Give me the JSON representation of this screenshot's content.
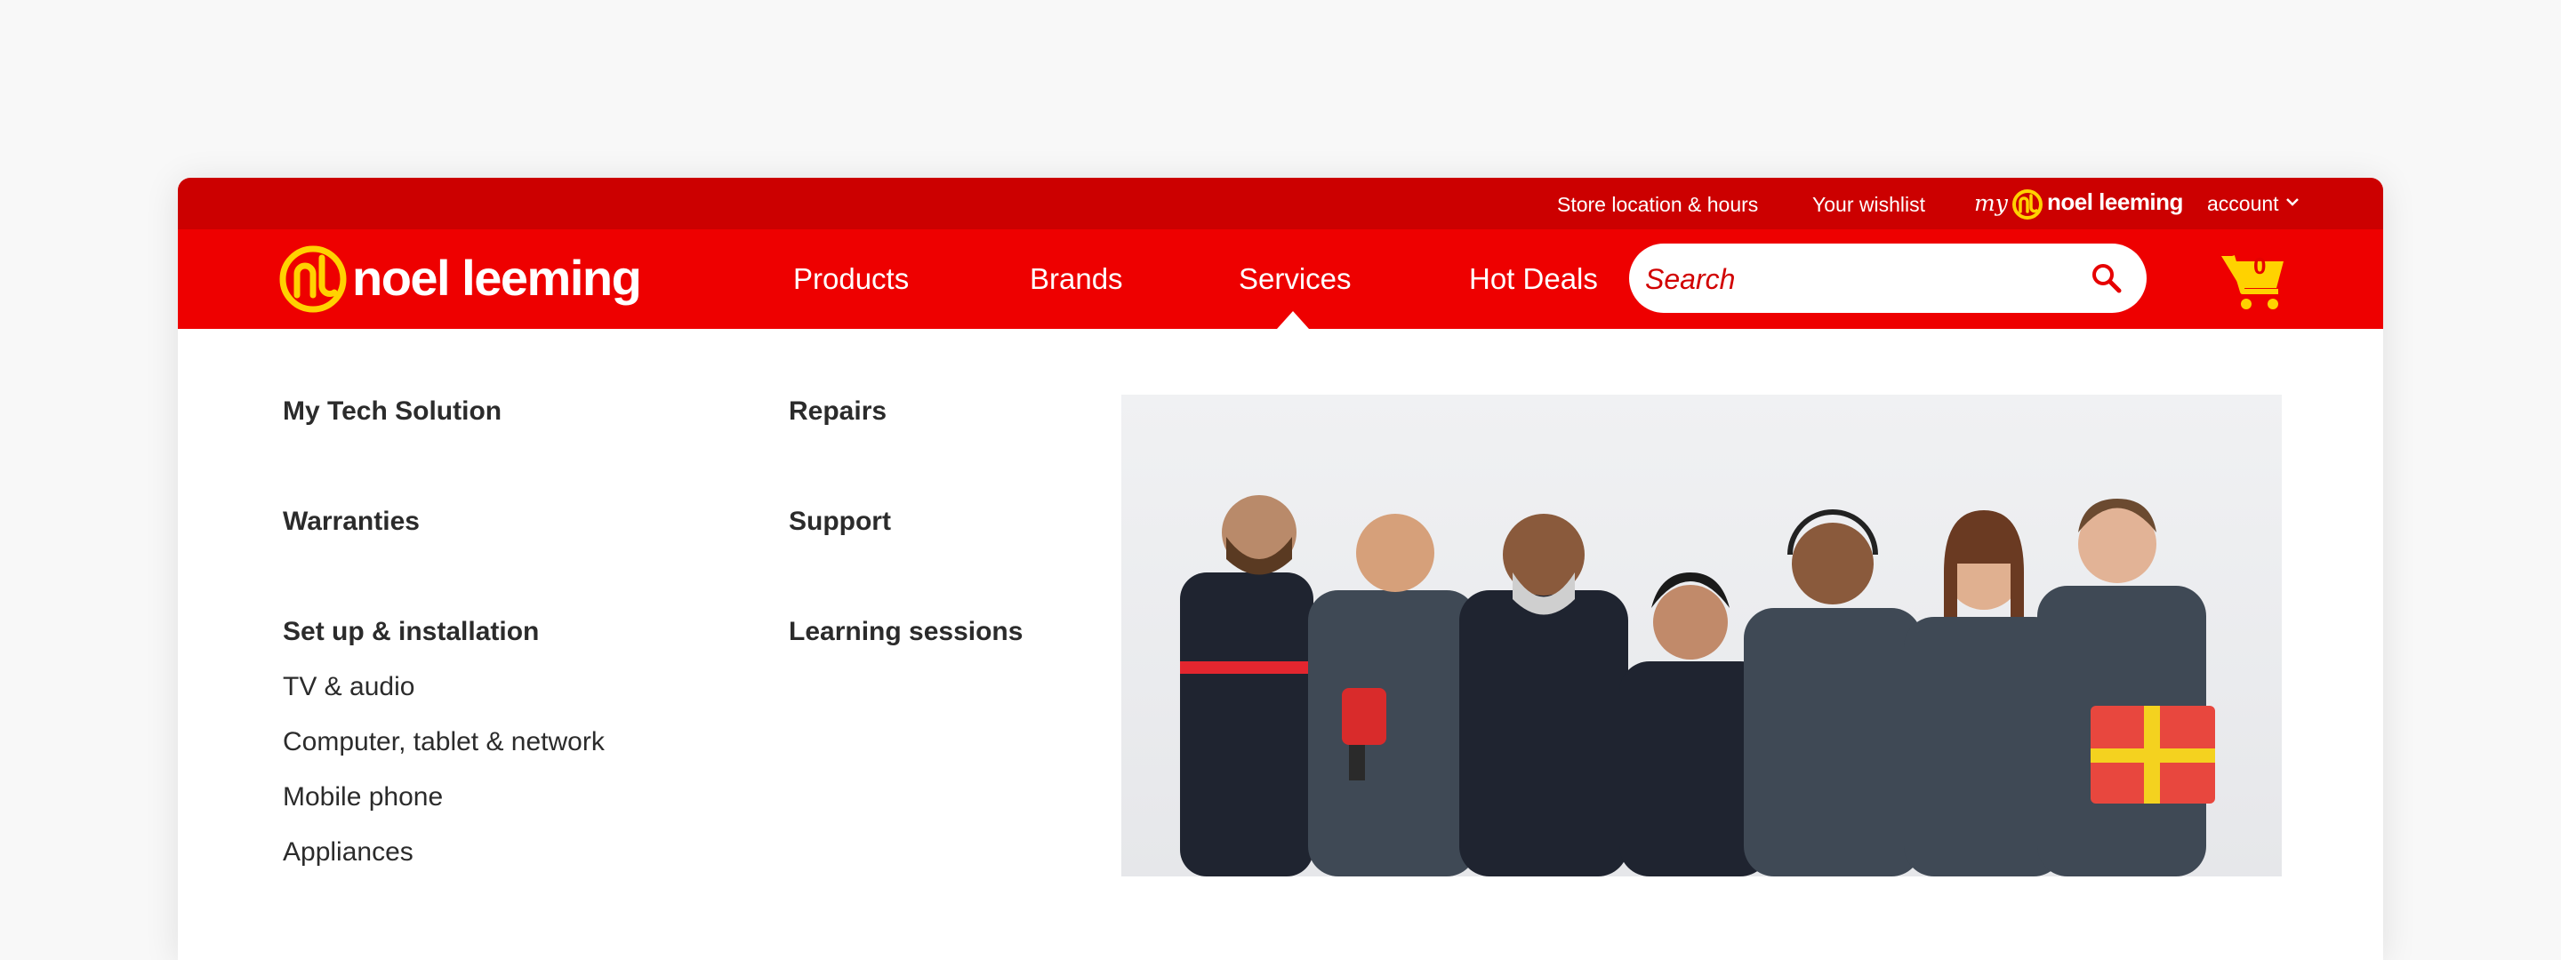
{
  "utility": {
    "store_link": "Store location & hours",
    "wishlist_link": "Your wishlist",
    "account": {
      "my": "my",
      "brand": "noel leeming",
      "label": "account"
    }
  },
  "header": {
    "brand": "noel leeming",
    "nav": [
      "Products",
      "Brands",
      "Services",
      "Hot Deals"
    ],
    "active_nav": "Services",
    "search": {
      "placeholder": "Search"
    },
    "cart": {
      "count": "0"
    }
  },
  "menu": {
    "col1": {
      "my_tech_solution": "My Tech Solution",
      "warranties": "Warranties",
      "setup": "Set up & installation",
      "setup_items": [
        "TV & audio",
        "Computer, tablet & network",
        "Mobile phone",
        "Appliances"
      ]
    },
    "col2": {
      "repairs": "Repairs",
      "support": "Support",
      "learning": "Learning sessions"
    }
  },
  "colors": {
    "utility_bar": "#cc0000",
    "main_bar": "#ee0000",
    "logo_yellow": "#ffd200",
    "text_dark": "#2b2b2b"
  },
  "icons": {
    "logo": "nl-logo-icon",
    "search": "search-icon",
    "cart": "cart-icon",
    "account_chevron": "chevron-down-icon"
  }
}
